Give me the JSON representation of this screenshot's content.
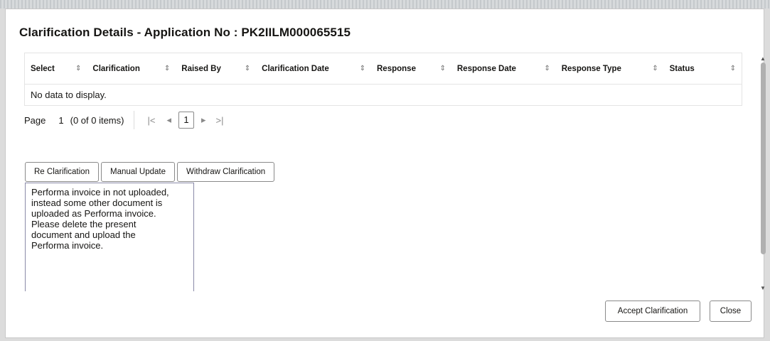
{
  "dialog": {
    "title": "Clarification Details - Application No : PK2IILM000065515"
  },
  "table": {
    "columns": [
      "Select",
      "Clarification",
      "Raised By",
      "Clarification Date",
      "Response",
      "Response Date",
      "Response Type",
      "Status"
    ],
    "sort_icon": "⇕",
    "empty_text": "No data to display."
  },
  "pager": {
    "page_label": "Page",
    "page_value": "1",
    "items_text": "(0 of 0 items)",
    "first_icon": "|<",
    "prev_icon": "◂",
    "current_page": "1",
    "next_icon": "▸",
    "last_icon": ">|"
  },
  "actions": {
    "re_clarification": "Re Clarification",
    "manual_update": "Manual Update",
    "withdraw_clarification": "Withdraw Clarification"
  },
  "note_text": "Performa invoice in not uploaded,\ninstead some other document is\nuploaded as Performa invoice.\nPlease delete the present\ndocument and upload the\nPerforma invoice.",
  "footer": {
    "accept_label": "Accept Clarification",
    "close_label": "Close"
  }
}
